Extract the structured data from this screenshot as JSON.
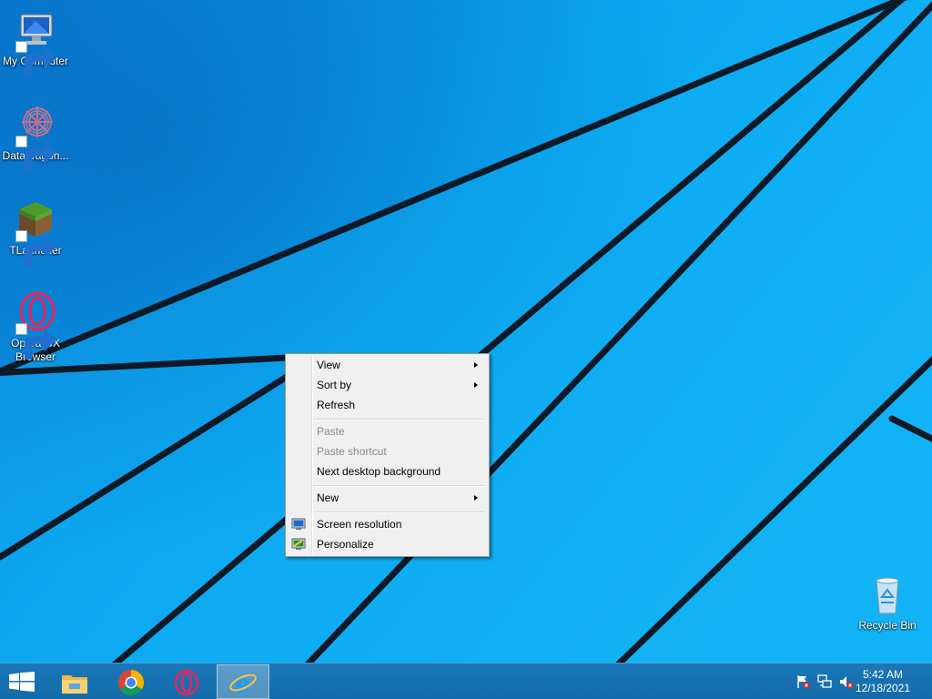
{
  "desktop": {
    "icons": [
      {
        "label": "My Computer"
      },
      {
        "label": "DataWagon..."
      },
      {
        "label": "TLauncher"
      },
      {
        "label": "Opera GX Browser"
      },
      {
        "label": "Recycle Bin"
      }
    ]
  },
  "context_menu": {
    "items": [
      {
        "label": "View"
      },
      {
        "label": "Sort by"
      },
      {
        "label": "Refresh"
      },
      {
        "label": "Paste"
      },
      {
        "label": "Paste shortcut"
      },
      {
        "label": "Next desktop background"
      },
      {
        "label": "New"
      },
      {
        "label": "Screen resolution"
      },
      {
        "label": "Personalize"
      }
    ]
  },
  "taskbar": {
    "clock_time": "5:42 AM",
    "clock_date": "12/18/2021",
    "pinned": [
      "windows-logo-icon",
      "file-explorer-icon",
      "chrome-icon",
      "opera-gx-icon",
      "internet-explorer-icon"
    ]
  },
  "colors": {
    "wallpaper": "#08a2ee",
    "taskbar": "#1773b4"
  }
}
